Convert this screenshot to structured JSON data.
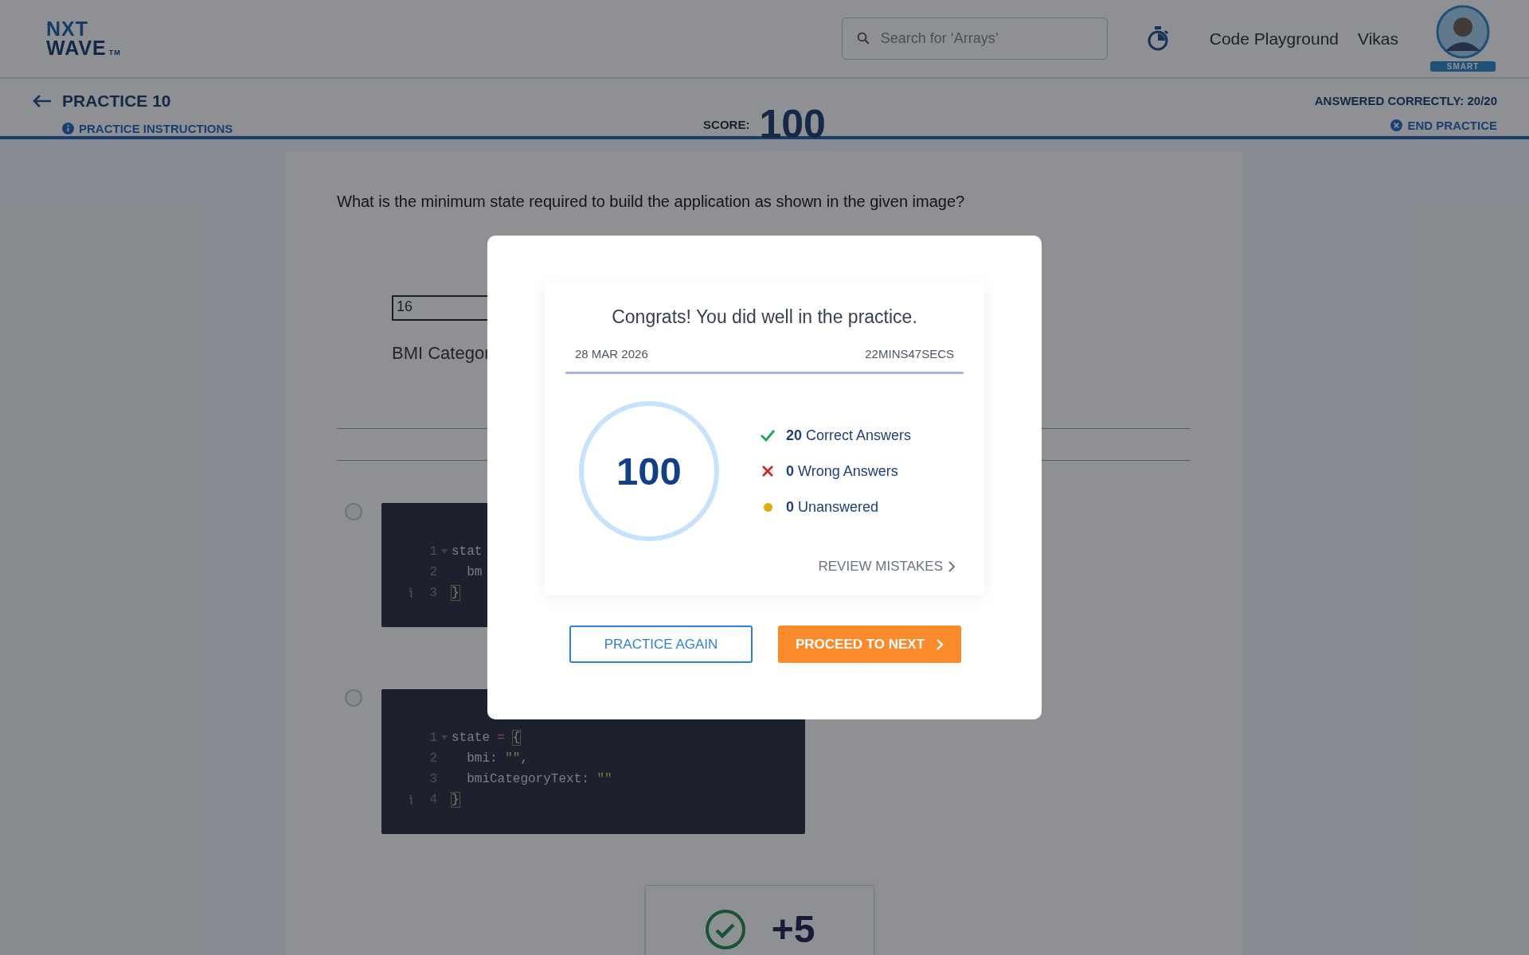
{
  "header": {
    "logo": {
      "top": "NXT",
      "bottom": "WAVE",
      "mark": "TM"
    },
    "search": {
      "placeholder": "Search for ‘Arrays’"
    },
    "link": "Code Playground",
    "user": "Vikas",
    "avatar_badge": "SMART"
  },
  "subheader": {
    "title": "PRACTICE 10",
    "instructions": "PRACTICE INSTRUCTIONS",
    "score_label": "SCORE:",
    "score": "100",
    "answered": "ANSWERED CORRECTLY: 20/20",
    "end": "END PRACTICE"
  },
  "question": {
    "text": "What is the minimum state required to build the application as shown in the given image?",
    "image": {
      "input_value": "16",
      "label": "BMI Categor"
    },
    "options": [
      {
        "selected": false,
        "lines": [
          {
            "num": "1",
            "fold": true,
            "info": false,
            "tokens": [
              {
                "kind": "ident",
                "text": "stat"
              }
            ]
          },
          {
            "num": "2",
            "fold": false,
            "info": false,
            "tokens": [
              {
                "kind": "ident",
                "text": "  bm"
              }
            ]
          },
          {
            "num": "3",
            "fold": false,
            "info": true,
            "tokens": [
              {
                "kind": "brace",
                "text": "}"
              }
            ]
          }
        ]
      },
      {
        "selected": false,
        "lines": [
          {
            "num": "1",
            "fold": true,
            "info": false,
            "tokens": [
              {
                "kind": "ident",
                "text": "state"
              },
              {
                "kind": "op",
                "text": " = "
              },
              {
                "kind": "brace",
                "text": "{"
              }
            ]
          },
          {
            "num": "2",
            "fold": false,
            "info": false,
            "tokens": [
              {
                "kind": "ident",
                "text": "  bmi: "
              },
              {
                "kind": "string",
                "text": "\"\""
              },
              {
                "kind": "ident",
                "text": ","
              }
            ]
          },
          {
            "num": "3",
            "fold": false,
            "info": false,
            "tokens": [
              {
                "kind": "ident",
                "text": "  bmiCategoryText: "
              },
              {
                "kind": "string",
                "text": "\"\""
              }
            ]
          },
          {
            "num": "4",
            "fold": false,
            "info": true,
            "tokens": [
              {
                "kind": "brace",
                "text": "}"
              }
            ]
          }
        ]
      }
    ],
    "result": {
      "correct": true,
      "points": "+5"
    }
  },
  "modal": {
    "title": "Congrats! You did well in the practice.",
    "date": "28 MAR 2026",
    "duration": "22MINS47SECS",
    "score": "100",
    "stats": [
      {
        "kind": "correct",
        "count": "20",
        "label": "Correct Answers"
      },
      {
        "kind": "wrong",
        "count": "0",
        "label": "Wrong Answers"
      },
      {
        "kind": "unanswered",
        "count": "0",
        "label": "Unanswered"
      }
    ],
    "review": "REVIEW MISTAKES",
    "buttons": [
      {
        "kind": "outline",
        "label": "PRACTICE AGAIN"
      },
      {
        "kind": "primary",
        "label": "PROCEED TO NEXT"
      }
    ]
  }
}
